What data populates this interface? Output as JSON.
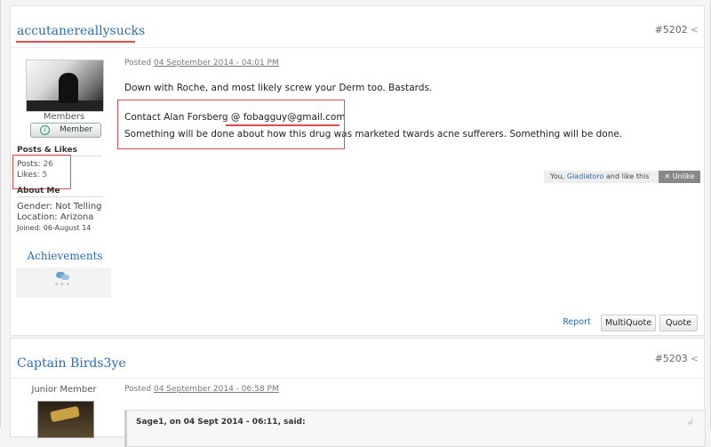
{
  "post1": {
    "username": "accutanereallysucks",
    "post_number": "#5202",
    "share_icon": "share-icon",
    "rank": "Members",
    "badge_label": "Member",
    "posts_likes_title": "Posts & Likes",
    "posts_label": "Posts:",
    "posts_value": "26",
    "likes_label": "Likes:",
    "likes_value": "5",
    "about_title": "About Me",
    "gender": "Gender: Not Telling",
    "location": "Location: Arizona",
    "joined": "Joined: 06-August 14",
    "achievements_title": "Achievements",
    "posted_label": "Posted",
    "posted_date": "04 September 2014 - 04:01 PM",
    "line1": "Down with Roche, and most likely screw your Derm too. Bastards.",
    "contact_prefix": "Contact Alan Forsberg ",
    "contact_email": "@ fobagguy@gmail.com",
    "line3": "Something will be done about how this drug was marketed twards acne sufferers. Something will be done.",
    "likes_you": "You, ",
    "likes_who": "Gladiatoro",
    "likes_suffix": " and like this",
    "unlike_label": "✕  Unlike",
    "report_label": "Report",
    "multiquote_label": "MultiQuote",
    "quote_label": "Quote"
  },
  "post2": {
    "username": "Captain Birds3ye",
    "post_number": "#5203",
    "rank": "Junior Member",
    "posted_label": "Posted",
    "posted_date": "04 September 2014 - 06:58 PM",
    "quote_header": "Sage1, on 04 Sept 2014 - 06:11, said:"
  },
  "colors": {
    "link": "#2a6db3",
    "highlight_red": "#e74c4c"
  }
}
